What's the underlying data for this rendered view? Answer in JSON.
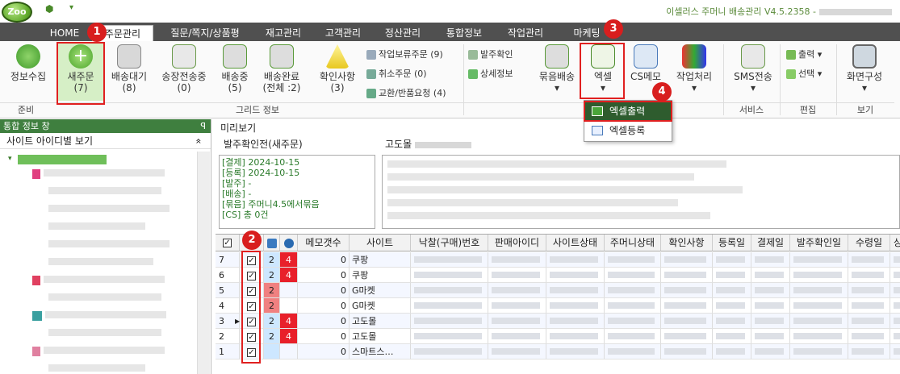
{
  "app": {
    "logo": "Zoo",
    "title": "이셀러스 주머니 배송관리 V4.5.2358 -"
  },
  "tabs": [
    {
      "label": "HOME"
    },
    {
      "label": "주문관리"
    },
    {
      "label": "질문/쪽지/상품평"
    },
    {
      "label": "재고관리"
    },
    {
      "label": "고객관리"
    },
    {
      "label": "정산관리"
    },
    {
      "label": "통합정보"
    },
    {
      "label": "작업관리"
    },
    {
      "label": "마케팅"
    }
  ],
  "ribbon": {
    "info_collect": "정보수집",
    "new_order": "새주문",
    "new_order_count": "(7)",
    "ship_wait": "배송대기",
    "ship_wait_count": "(8)",
    "invoice_sending": "송장전송중",
    "invoice_sending_count": "(0)",
    "shipping": "배송중",
    "shipping_count": "(5)",
    "ship_done": "배송완료",
    "ship_done_count": "(전체 :2)",
    "check_issue": "확인사항",
    "check_issue_count": "(3)",
    "work_hold": "작업보류주문 (9)",
    "cancel_order": "취소주문 (0)",
    "exchange_return": "교환/반품요청 (4)",
    "order_confirm": "발주확인",
    "detail_info": "상세정보",
    "bundle_ship": "묶음배송",
    "excel": "엑셀",
    "cs_memo": "CS메모",
    "work_process": "작업처리",
    "sms_send": "SMS전송",
    "print": "출력",
    "select": "선택",
    "screen_config": "화면구성",
    "group_prep": "준비",
    "group_grid": "그리드 정보",
    "group_order": "주",
    "group_service": "서비스",
    "group_edit": "편집",
    "group_view": "보기"
  },
  "badges": [
    "1",
    "2",
    "3",
    "4"
  ],
  "dropdown": {
    "excel_export": "엑셀출력",
    "excel_import": "엑셀등록"
  },
  "left_panel": {
    "title": "통합 정보 창",
    "pin": "ꟼ",
    "subtitle": "사이트 아이디별 보기",
    "collapse": "»"
  },
  "preview": {
    "label": "미리보기",
    "left_title": "발주확인전(새주문)",
    "right_title": "고도몰",
    "lines": [
      "[결제] 2024-10-15",
      "[등록] 2024-10-15",
      "[발주] -",
      "[배송] -",
      "[묶음] 주머니4.5에서묶음",
      "[CS] 총 0건"
    ]
  },
  "grid": {
    "headers": [
      "메모갯수",
      "사이트",
      "낙찰(구매)번호",
      "판매아이디",
      "사이트상태",
      "주머니상태",
      "확인사항",
      "등록일",
      "결제일",
      "발주확인일",
      "수령일",
      "상"
    ],
    "rows": [
      {
        "num": "7",
        "a": "2",
        "b": "4",
        "memo": "0",
        "site": "쿠팡"
      },
      {
        "num": "6",
        "a": "2",
        "b": "4",
        "memo": "0",
        "site": "쿠팡"
      },
      {
        "num": "5",
        "a": "2",
        "b": "",
        "memo": "0",
        "site": "G마켓"
      },
      {
        "num": "4",
        "a": "2",
        "b": "",
        "memo": "0",
        "site": "G마켓"
      },
      {
        "num": "3",
        "a": "2",
        "b": "4",
        "memo": "0",
        "site": "고도몰"
      },
      {
        "num": "2",
        "a": "2",
        "b": "4",
        "memo": "0",
        "site": "고도몰"
      },
      {
        "num": "1",
        "a": "",
        "b": "",
        "memo": "0",
        "site": "스마트스…"
      }
    ]
  },
  "colors": {
    "accent_green": "#3f7f3f",
    "highlight_red": "#e02020",
    "cell_red": "#e8202a",
    "cell_pink": "#f08080",
    "tab_bar": "#505050"
  }
}
